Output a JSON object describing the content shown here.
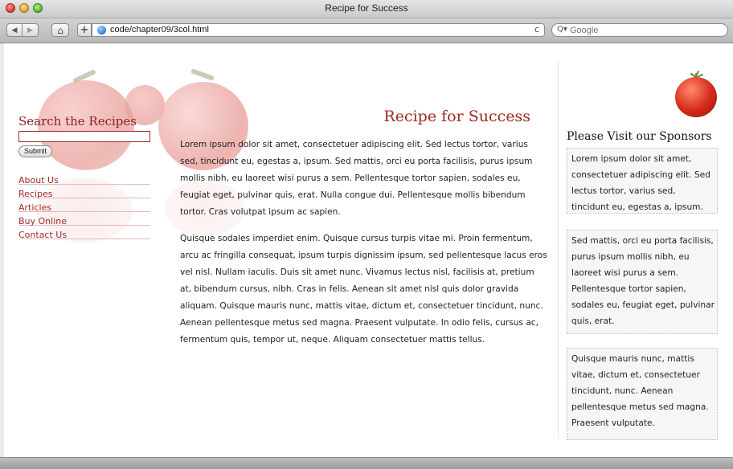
{
  "window": {
    "title": "Recipe for Success"
  },
  "toolbar": {
    "back_label": "◀",
    "forward_label": "▶",
    "home_label": "⌂",
    "add_label": "+",
    "url": "code/chapter09/3col.html",
    "reload_label": "c",
    "search_placeholder": "Google"
  },
  "left": {
    "search_heading": "Search the Recipes",
    "submit_label": "Submit",
    "nav": [
      "About Us",
      "Recipes",
      "Articles",
      "Buy Online",
      "Contact Us"
    ]
  },
  "main": {
    "title": "Recipe for Success",
    "paragraphs": [
      "Lorem ipsum dolor sit amet, consectetuer adipiscing elit. Sed lectus tortor, varius sed, tincidunt eu, egestas a, ipsum. Sed mattis, orci eu porta facilisis, purus ipsum mollis nibh, eu laoreet wisi purus a sem. Pellentesque tortor sapien, sodales eu, feugiat eget, pulvinar quis, erat. Nulla congue dui. Pellentesque mollis bibendum tortor. Cras volutpat ipsum ac sapien.",
      "Quisque sodales imperdiet enim. Quisque cursus turpis vitae mi. Proin fermentum, arcu ac fringilla consequat, ipsum turpis dignissim ipsum, sed pellentesque lacus eros vel nisl. Nullam iaculis. Duis sit amet nunc. Vivamus lectus nisl, facilisis at, pretium at, bibendum cursus, nibh. Cras in felis. Aenean sit amet nisl quis dolor gravida aliquam. Quisque mauris nunc, mattis vitae, dictum et, consectetuer tincidunt, nunc. Aenean pellentesque metus sed magna. Praesent vulputate. In odio felis, cursus ac, fermentum quis, tempor ut, neque. Aliquam consectetuer mattis tellus."
    ]
  },
  "right": {
    "heading": "Please Visit our Sponsors",
    "boxes": [
      "Lorem ipsum dolor sit amet, consectetuer adipiscing elit. Sed lectus tortor, varius sed, tincidunt eu, egestas a, ipsum.",
      "Sed mattis, orci eu porta facilisis, purus ipsum mollis nibh, eu laoreet wisi purus a sem. Pellentesque tortor sapien, sodales eu, feugiat eget, pulvinar quis, erat.",
      "Quisque mauris nunc, mattis vitae, dictum et, consectetuer tincidunt, nunc. Aenean pellentesque metus sed magna. Praesent vulputate."
    ]
  },
  "colors": {
    "accent_red": "#9b2a22",
    "nav_link": "#a22a2a",
    "tomato_red": "#d42a18"
  }
}
